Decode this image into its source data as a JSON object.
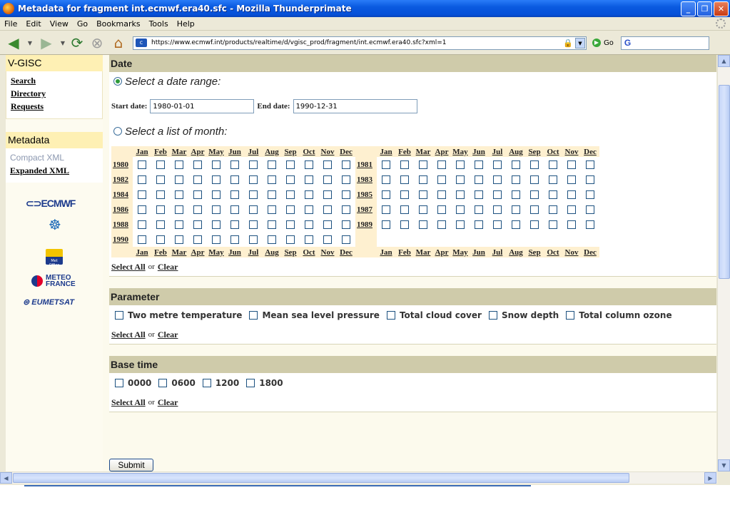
{
  "window": {
    "title": "Metadata for fragment int.ecmwf.era40.sfc - Mozilla Thunderprimate"
  },
  "menu": [
    "File",
    "Edit",
    "View",
    "Go",
    "Bookmarks",
    "Tools",
    "Help"
  ],
  "nav": {
    "url": "https://www.ecmwf.int/products/realtime/d/vgisc_prod/fragment/int.ecmwf.era40.sfc?xml=1",
    "go_label": "Go",
    "search_value": "G"
  },
  "sidebar": {
    "title1": "V-GISC",
    "links1": [
      "Search",
      "Directory",
      "Requests"
    ],
    "title2": "Metadata",
    "links2": [
      "Compact XML",
      "Expanded XML"
    ],
    "logos": [
      "ECMWF",
      "Met Office",
      "METEO",
      "FRANCE",
      "EUMETSAT"
    ]
  },
  "date": {
    "header": "Date",
    "range_label": "Select a date range:",
    "start_label": "Start date:",
    "start_value": "1980-01-01",
    "end_label": "End date:",
    "end_value": "1990-12-31",
    "month_label": "Select a list of month:",
    "months": [
      "Jan",
      "Feb",
      "Mar",
      "Apr",
      "May",
      "Jun",
      "Jul",
      "Aug",
      "Sep",
      "Oct",
      "Nov",
      "Dec"
    ],
    "rows": [
      [
        "1980",
        "1981"
      ],
      [
        "1982",
        "1983"
      ],
      [
        "1984",
        "1985"
      ],
      [
        "1986",
        "1987"
      ],
      [
        "1988",
        "1989"
      ],
      [
        "1990",
        ""
      ]
    ]
  },
  "select": {
    "all": "Select All",
    "or": "or",
    "clear": "Clear"
  },
  "parameter": {
    "header": "Parameter",
    "items": [
      "Two metre temperature",
      "Mean sea level pressure",
      "Total cloud cover",
      "Snow depth",
      "Total column ozone"
    ]
  },
  "basetime": {
    "header": "Base time",
    "items": [
      "0000",
      "0600",
      "1200",
      "1800"
    ]
  },
  "submit": "Submit"
}
